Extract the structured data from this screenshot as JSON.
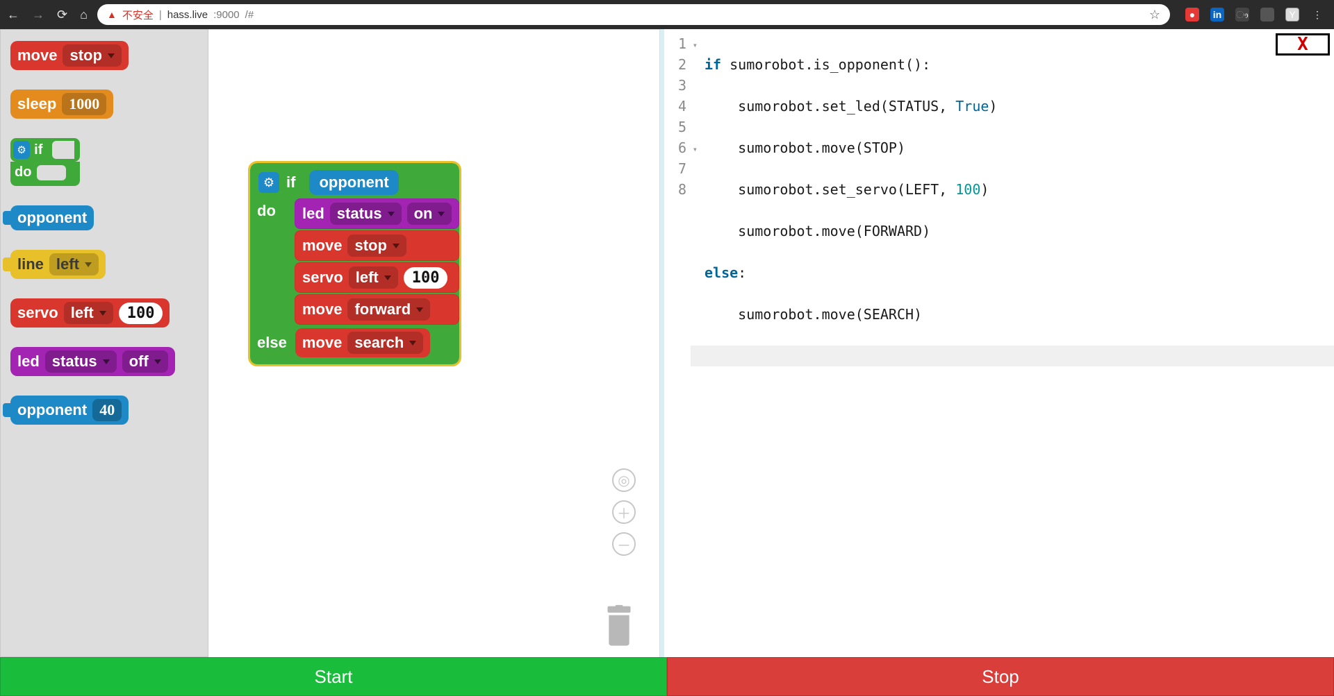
{
  "browser": {
    "not_secure": "不安全",
    "host": "hass.live",
    "port": ":9000",
    "hash": "/#"
  },
  "toolbox": {
    "move_label": "move",
    "move_value": "stop",
    "sleep_label": "sleep",
    "sleep_value": "1000",
    "if_label": "if",
    "do_label": "do",
    "opponent_label": "opponent",
    "line_label": "line",
    "line_value": "left",
    "servo_label": "servo",
    "servo_side": "left",
    "servo_value": "100",
    "led_label": "led",
    "led_target": "status",
    "led_state": "off",
    "opponent2_label": "opponent",
    "opponent2_value": "40"
  },
  "canvas_block": {
    "if_label": "if",
    "if_cond": "opponent",
    "do_label": "do",
    "led_label": "led",
    "led_target": "status",
    "led_state": "on",
    "move1_label": "move",
    "move1_value": "stop",
    "servo_label": "servo",
    "servo_side": "left",
    "servo_value": "100",
    "move2_label": "move",
    "move2_value": "forward",
    "else_label": "else",
    "move3_label": "move",
    "move3_value": "search"
  },
  "code": {
    "l1a": "if",
    "l1b": " sumorobot.is_opponent():",
    "l2": "    sumorobot.set_led(STATUS, ",
    "l2b": "True",
    "l2c": ")",
    "l3": "    sumorobot.move(STOP)",
    "l4": "    sumorobot.set_servo(LEFT, ",
    "l4b": "100",
    "l4c": ")",
    "l5": "    sumorobot.move(FORWARD)",
    "l6a": "else",
    "l6b": ":",
    "l7": "    sumorobot.move(SEARCH)",
    "line_numbers": [
      "1",
      "2",
      "3",
      "4",
      "5",
      "6",
      "7",
      "8"
    ]
  },
  "footer": {
    "start": "Start",
    "stop": "Stop"
  },
  "close_x": "X"
}
